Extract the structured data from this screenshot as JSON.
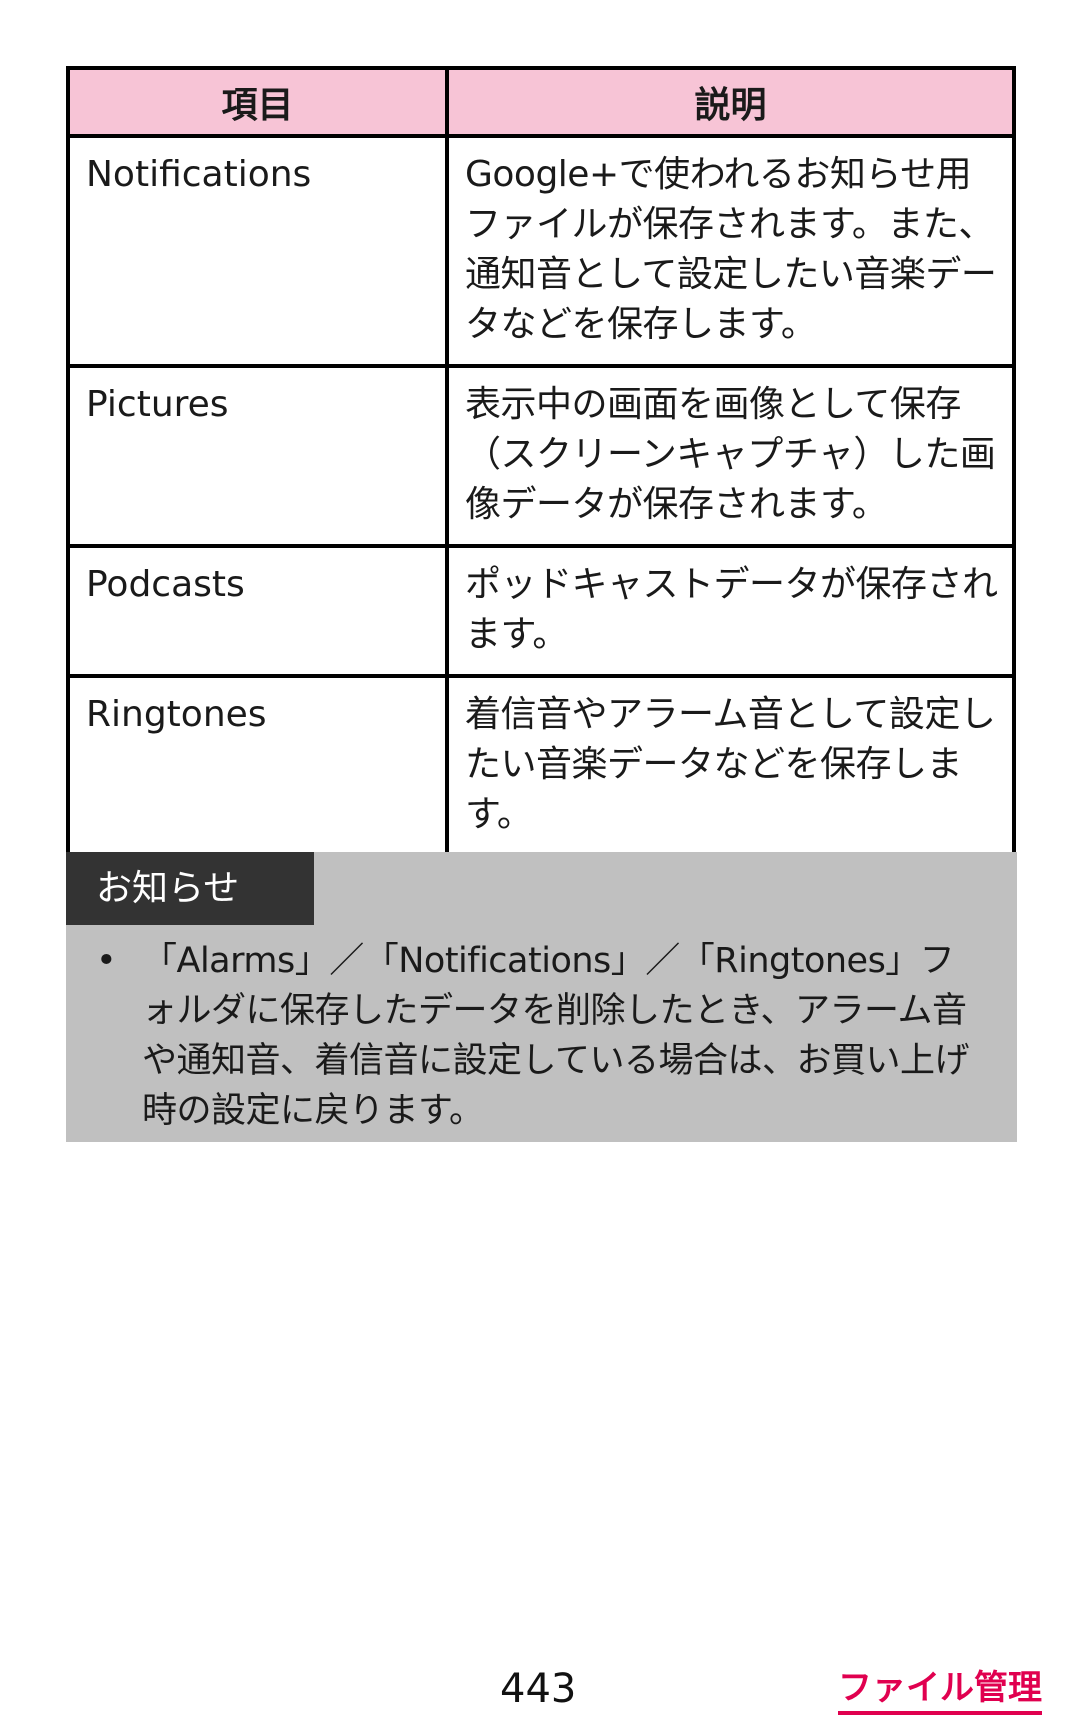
{
  "table": {
    "headers": [
      "項目",
      "説明"
    ],
    "rows": [
      {
        "item": "Notifications",
        "desc": "Google+で使われるお知らせ用ファイルが保存されます。また、通知音として設定したい音楽データなどを保存します。"
      },
      {
        "item": "Pictures",
        "desc": "表示中の画面を画像として保存（スクリーンキャプチャ）した画像データが保存されます。"
      },
      {
        "item": "Podcasts",
        "desc": "ポッドキャストデータが保存されます。"
      },
      {
        "item": "Ringtones",
        "desc": "着信音やアラーム音として設定したい音楽データなどを保存します。"
      }
    ]
  },
  "note": {
    "tag": "お知らせ",
    "bullet": "•",
    "text": "「Alarms」／「Notifications」／「Ringtones」フォルダに保存したデータを削除したとき、アラーム音や通知音、着信音に設定している場合は、お買い上げ時の設定に戻ります。"
  },
  "footer": {
    "page_number": "443",
    "section": "ファイル管理"
  },
  "colors": {
    "header_bg": "#f7c4d6",
    "note_bg": "#c0c0c0",
    "note_tag_bg": "#333333",
    "accent": "#e0004f"
  }
}
